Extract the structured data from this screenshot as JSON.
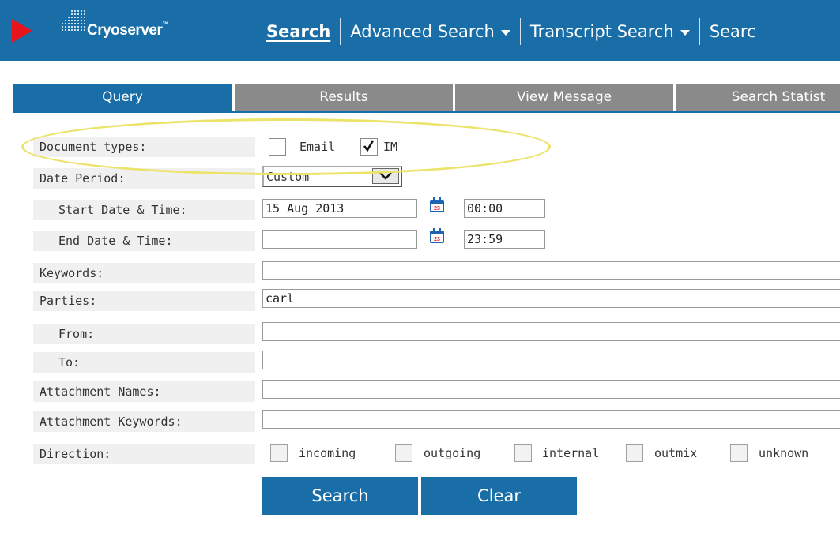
{
  "app": {
    "name": "Cryoserver",
    "trademark": "™"
  },
  "nav": {
    "items": [
      {
        "label": "Search",
        "active": true
      },
      {
        "label": "Advanced Search"
      },
      {
        "label": "Transcript Search"
      },
      {
        "label": "Searc"
      }
    ]
  },
  "tabs": [
    "Query",
    "Results",
    "View Message",
    "Search Statist"
  ],
  "form": {
    "document_types": {
      "label": "Document types:",
      "email_label": "Email",
      "email_checked": false,
      "im_label": "IM",
      "im_checked": true
    },
    "date_period": {
      "label": "Date Period:",
      "value": "Custom"
    },
    "start": {
      "label": "Start Date & Time:",
      "date": "15 Aug 2013",
      "time": "00:00"
    },
    "end": {
      "label": "End Date & Time:",
      "date": "",
      "time": "23:59"
    },
    "keywords": {
      "label": "Keywords:",
      "value": ""
    },
    "parties": {
      "label": "Parties:",
      "value": "carl"
    },
    "from": {
      "label": "From:",
      "value": ""
    },
    "to": {
      "label": "To:",
      "value": ""
    },
    "attachment_names": {
      "label": "Attachment Names:",
      "value": ""
    },
    "attachment_keywords": {
      "label": "Attachment Keywords:",
      "value": ""
    },
    "direction": {
      "label": "Direction:",
      "options": [
        "incoming",
        "outgoing",
        "internal",
        "outmix",
        "unknown"
      ]
    }
  },
  "buttons": {
    "search": "Search",
    "clear": "Clear"
  },
  "icons": {
    "calendar": "calendar-icon",
    "calendar_day": "23"
  },
  "colors": {
    "primary": "#1a6ea8",
    "tab_inactive": "#8a8a8a",
    "alert": "#e8141c",
    "highlight": "#ece36a"
  }
}
